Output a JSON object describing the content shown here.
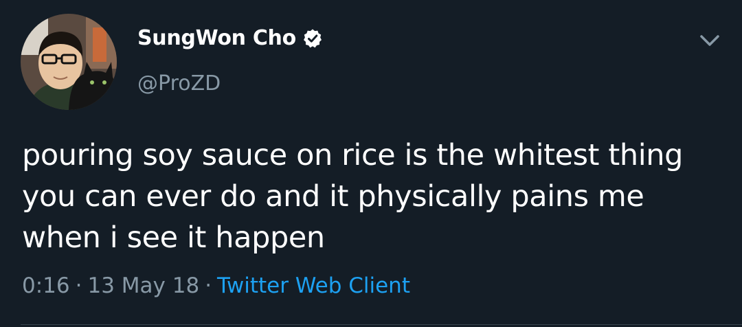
{
  "tweet": {
    "author": {
      "display_name": "SungWon Cho",
      "handle": "@ProZD",
      "verified": true,
      "avatar_icon": "avatar-photo-with-cat"
    },
    "text": "pouring soy sauce on rice is the whitest thing you can ever do and it physically pains me when i see it happen",
    "time": "0:16",
    "date": "13 May 18",
    "separator": "·",
    "client": "Twitter Web Client",
    "menu_icon": "chevron-down-icon"
  },
  "colors": {
    "background": "#141d26",
    "text_primary": "#ffffff",
    "text_secondary": "#8899a6",
    "link": "#1da1f2",
    "verified_badge": "#ffffff",
    "divider": "#38444d"
  }
}
